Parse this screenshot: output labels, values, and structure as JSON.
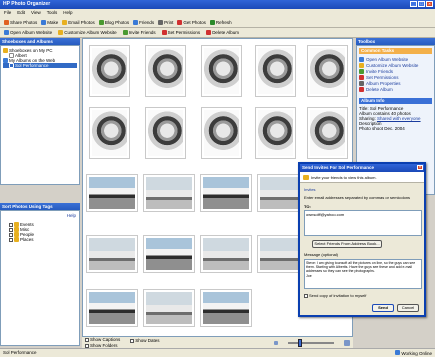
{
  "window": {
    "title": "HP Photo Organizer"
  },
  "menu": [
    "File",
    "Edit",
    "View",
    "Tools",
    "Help"
  ],
  "toolbar1": [
    {
      "label": "Share Photos",
      "color": "#e06020"
    },
    {
      "label": "Make",
      "color": "#3a7ad6"
    },
    {
      "label": "Email Photos",
      "color": "#e8b020"
    },
    {
      "label": "Blog Photos",
      "color": "#4a9a30"
    },
    {
      "label": "Friends",
      "color": "#3a7ad6"
    },
    {
      "label": "Print",
      "color": "#666666"
    },
    {
      "label": "Get Photos",
      "color": "#d03030"
    },
    {
      "label": "Refresh",
      "color": "#2a8a2a"
    }
  ],
  "toolbar2": [
    {
      "label": "Open Album Website",
      "color": "#3a7ad6"
    },
    {
      "label": "Customize Album Website",
      "color": "#e8b020"
    },
    {
      "label": "Invite Friends",
      "color": "#4a9a30"
    },
    {
      "label": "Set Permissions",
      "color": "#d03030"
    },
    {
      "label": "Delete Album",
      "color": "#d03030"
    }
  ],
  "left": {
    "albums_header": "Shoeboxes and Albums",
    "tree": [
      {
        "label": "Shoeboxes on My PC",
        "indent": 0,
        "color": "#e8b020"
      },
      {
        "label": "Albert",
        "indent": 1,
        "color": "#ffffff"
      },
      {
        "label": "My Albums on the Web",
        "indent": 0,
        "color": "#3a7ad6"
      },
      {
        "label": "Sol Performance",
        "indent": 1,
        "color": "#ffffff"
      }
    ],
    "tags_header": "Sort Photos Using Tags",
    "tags_help": "Help",
    "tags": [
      "Events",
      "Misc",
      "People",
      "Places"
    ]
  },
  "bottom": {
    "show_captions": "Show Captions",
    "show_dates": "Show Dates",
    "show_folders": "Show Folders"
  },
  "right": {
    "toolbox_header": "Toolbox",
    "tasks_header": "Common Tasks",
    "tasks": [
      {
        "label": "Open Album Website",
        "color": "#3a7ad6"
      },
      {
        "label": "Customize Album Website",
        "color": "#e8b020"
      },
      {
        "label": "Invite Friends",
        "color": "#4a9a30"
      },
      {
        "label": "Set Permissions",
        "color": "#d03030"
      },
      {
        "label": "Album Properties",
        "color": "#666666"
      },
      {
        "label": "Delete Album",
        "color": "#d03030"
      }
    ],
    "info_header": "Album Info",
    "info_title": "Title: Sol Performance",
    "info_count": "Album contains 40 photos",
    "info_sharing_label": "Sharing:",
    "info_sharing_value": "Shared with everyone",
    "info_desc_label": "Description",
    "info_date": "Photo shoot Dec. 2004"
  },
  "dialog": {
    "title": "Send Invites For Sol Performance",
    "subtitle": "Invite your friends to view this album.",
    "section": "Invites",
    "instructions": "Enter email addresses separated by commas or semicolons",
    "to_label": "TO:",
    "to_value": "ownsolff@yahoo.com",
    "address_book_button": "Select Friends From Address Book...",
    "message_label": "Message (optional)",
    "message_text": "Steve: I am giving tounsoft all the pictures on line, so the guys can see them. Starting with Albertis. Have the guys see these and add e-mail addresses so they can see the photographs.",
    "message_sign": "Joe",
    "copy_label": "Send copy of invitation to myself",
    "send_button": "Send",
    "cancel_button": "Cancel"
  },
  "status": {
    "left": "Sol Performance",
    "right": "Working Online"
  }
}
